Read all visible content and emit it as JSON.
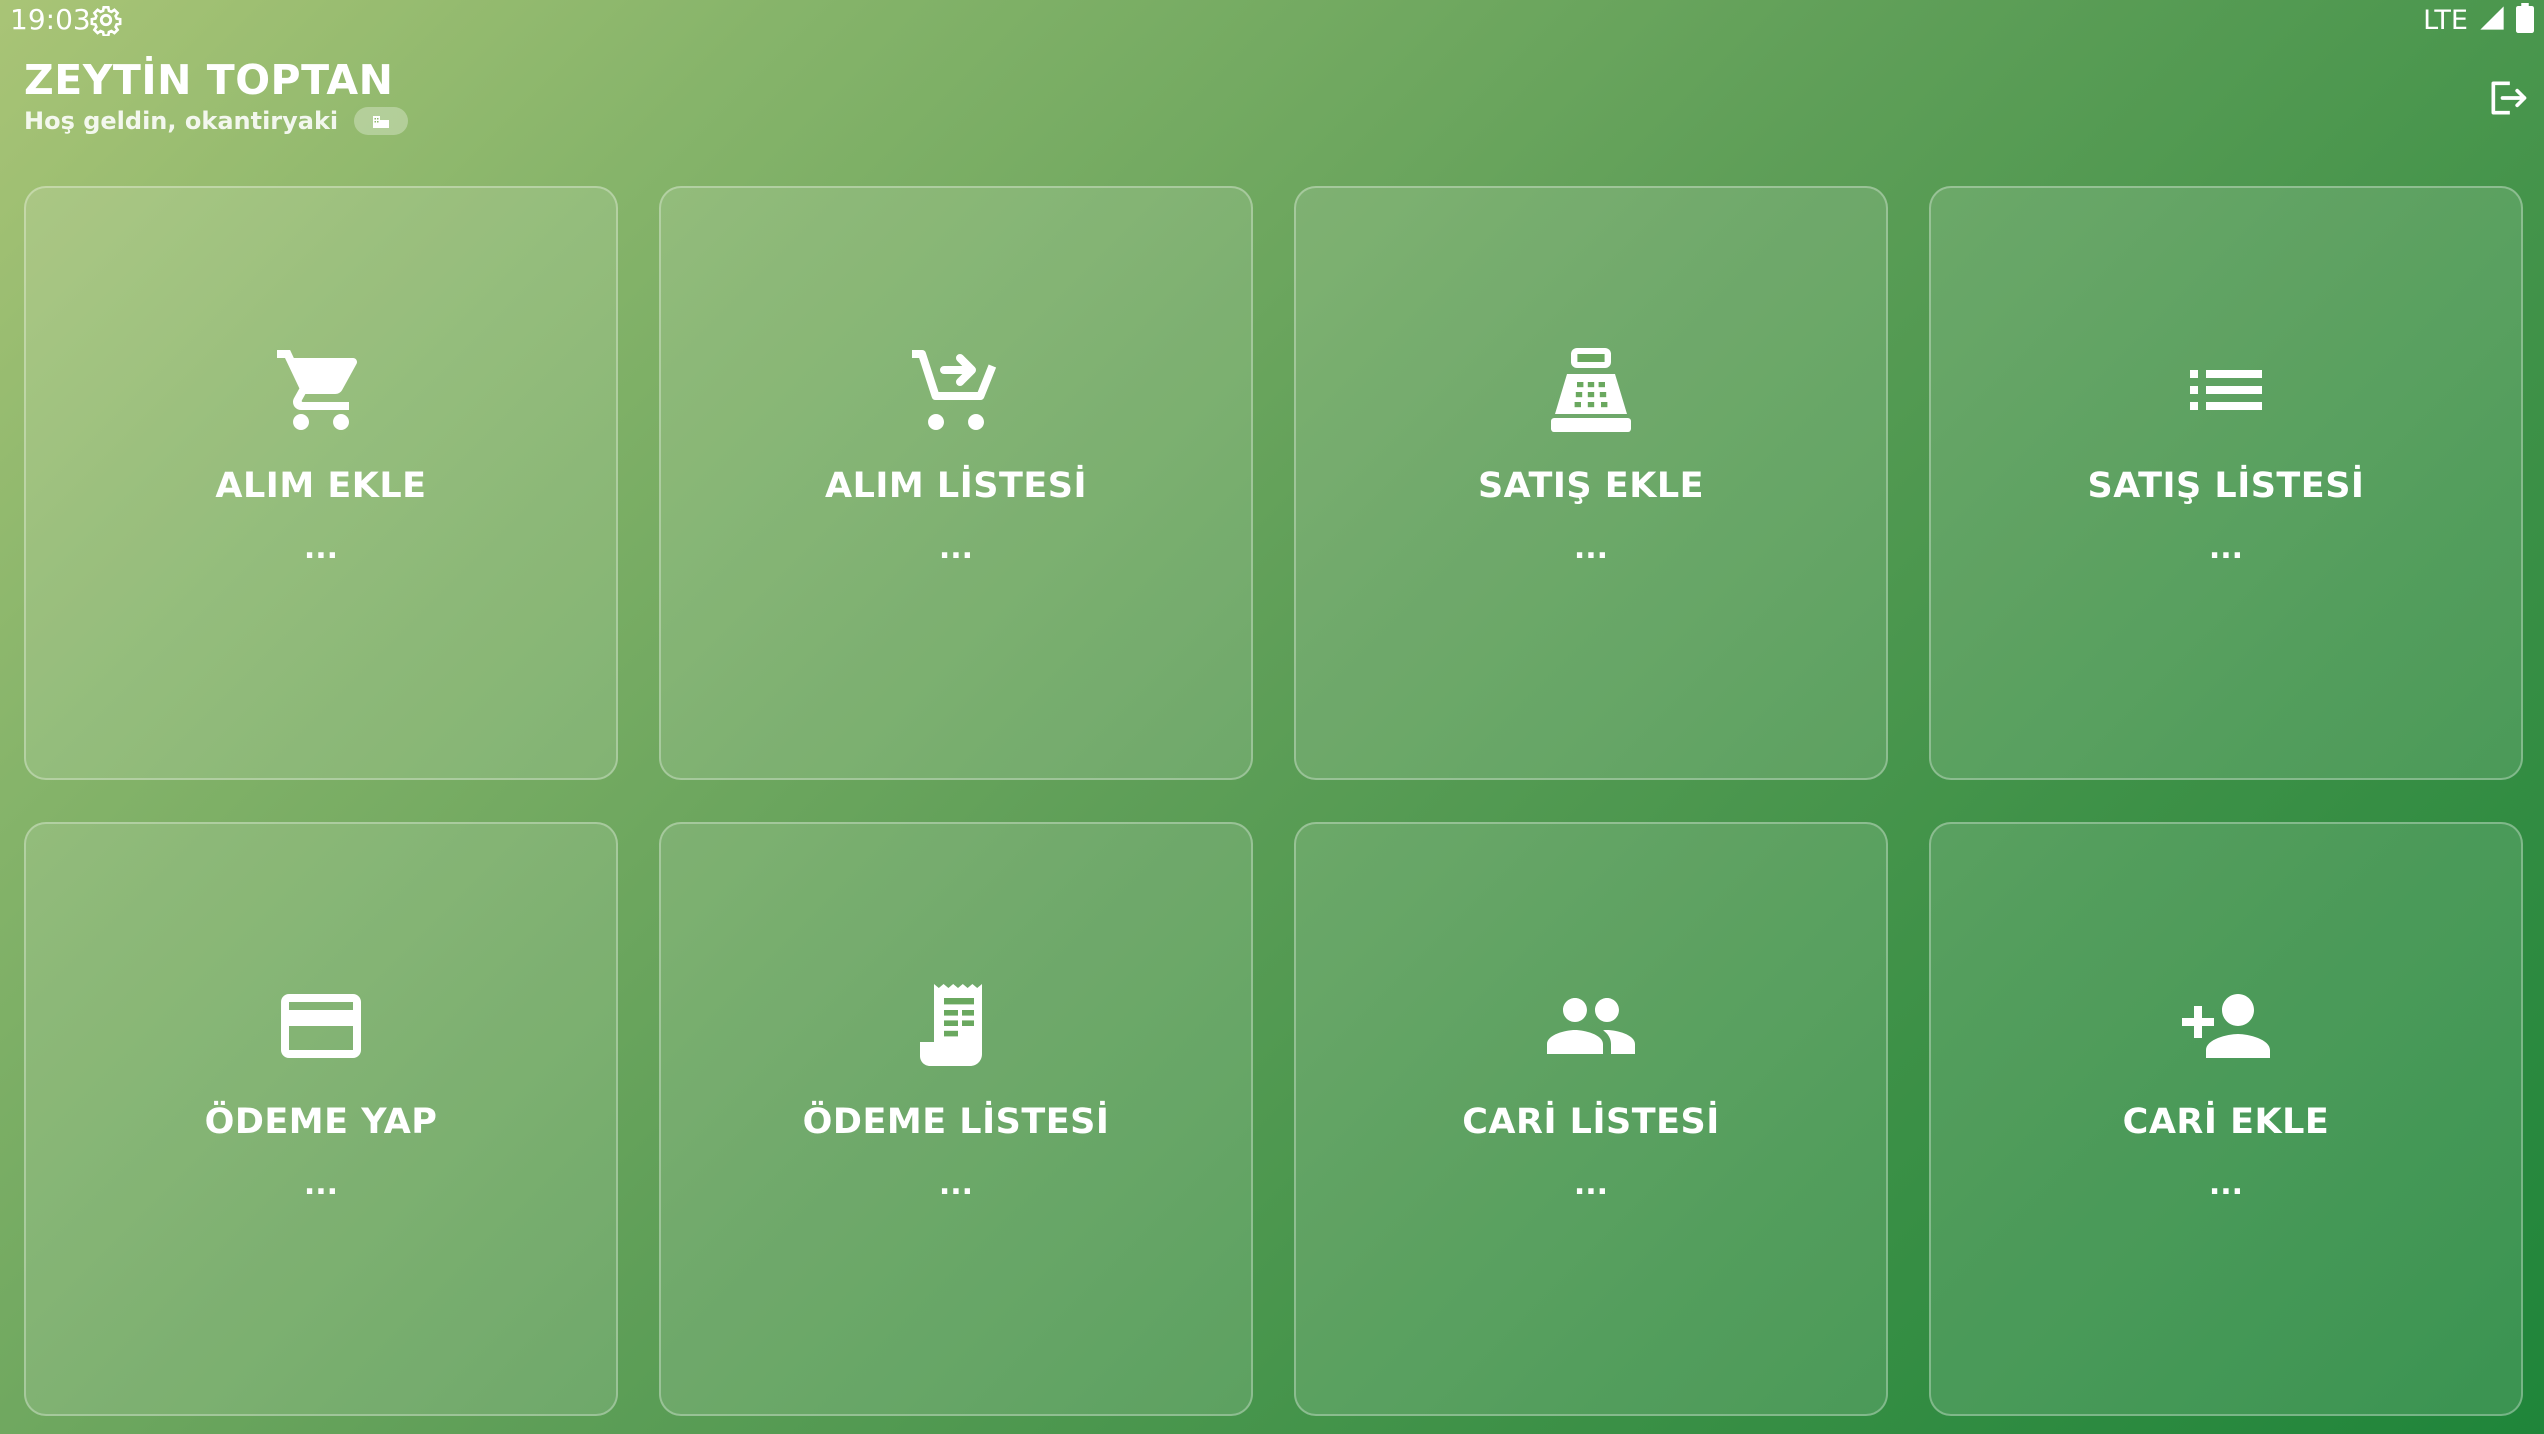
{
  "status_bar": {
    "time": "19:03",
    "network": "LTE",
    "icons": [
      "settings-gear-icon",
      "signal-icon",
      "battery-icon"
    ]
  },
  "header": {
    "title": "ZEYTİN TOPTAN",
    "greeting": "Hoş geldin, okantiryaki",
    "badge_icon": "business-icon",
    "logout_icon": "logout-icon"
  },
  "menu": {
    "items": [
      {
        "label": "ALIM EKLE",
        "sub": "...",
        "icon": "cart-icon"
      },
      {
        "label": "ALIM LİSTESİ",
        "sub": "...",
        "icon": "cart-arrow-icon"
      },
      {
        "label": "SATIŞ EKLE",
        "sub": "...",
        "icon": "cash-register-icon"
      },
      {
        "label": "SATIŞ LİSTESİ",
        "sub": "...",
        "icon": "list-icon"
      },
      {
        "label": "ÖDEME YAP",
        "sub": "...",
        "icon": "credit-card-icon"
      },
      {
        "label": "ÖDEME LİSTESİ",
        "sub": "...",
        "icon": "receipt-icon"
      },
      {
        "label": "CARİ LİSTESİ",
        "sub": "...",
        "icon": "people-icon"
      },
      {
        "label": "CARİ EKLE",
        "sub": "...",
        "icon": "person-add-icon"
      }
    ]
  },
  "colors": {
    "gradient_start": "#a9c476",
    "gradient_end": "#1f853a",
    "text": "#ffffff"
  }
}
